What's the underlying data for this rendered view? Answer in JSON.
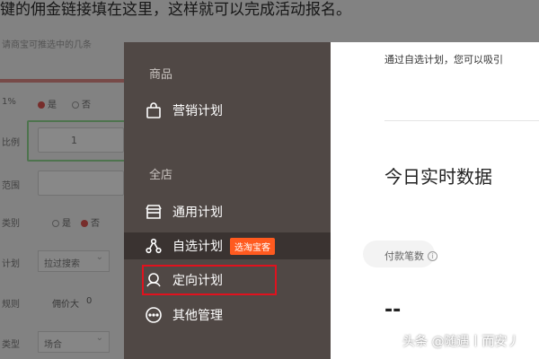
{
  "background_page": {
    "caption": "键的佣金链接填在这里，这样就可以完成活动报名。",
    "hint": "请商宝可推选中的几条",
    "rows": [
      {
        "label": "1%"
      },
      {
        "label": "比例"
      },
      {
        "label": "范围"
      },
      {
        "label": "类别"
      },
      {
        "label": "计划"
      },
      {
        "label": "规则"
      },
      {
        "label": "类型"
      }
    ],
    "radio_yes": "是",
    "radio_no": "否",
    "field_value": "1",
    "select1": "拉过搜索",
    "select2": "场合",
    "ratio_label": "佣价大",
    "ratio_value": "0"
  },
  "menu": {
    "group_goods": "商品",
    "item_marketing": "营销计划",
    "group_shop": "全店",
    "item_general": "通用计划",
    "item_selected": "自选计划",
    "item_selected_badge": "选淘宝客",
    "item_directed": "定向计划",
    "item_other": "其他管理"
  },
  "panel": {
    "description": "通过自选计划，您可以吸引",
    "title": "今日实时数据",
    "metric_label": "付款笔数",
    "metric_value": "--"
  },
  "watermark": "头条 @随遇丨而安丿",
  "colors": {
    "menu_bg": "#504845",
    "menu_active_bg": "#3a3331",
    "badge": "#ff5a1f",
    "annotation_box": "#e0121e"
  }
}
